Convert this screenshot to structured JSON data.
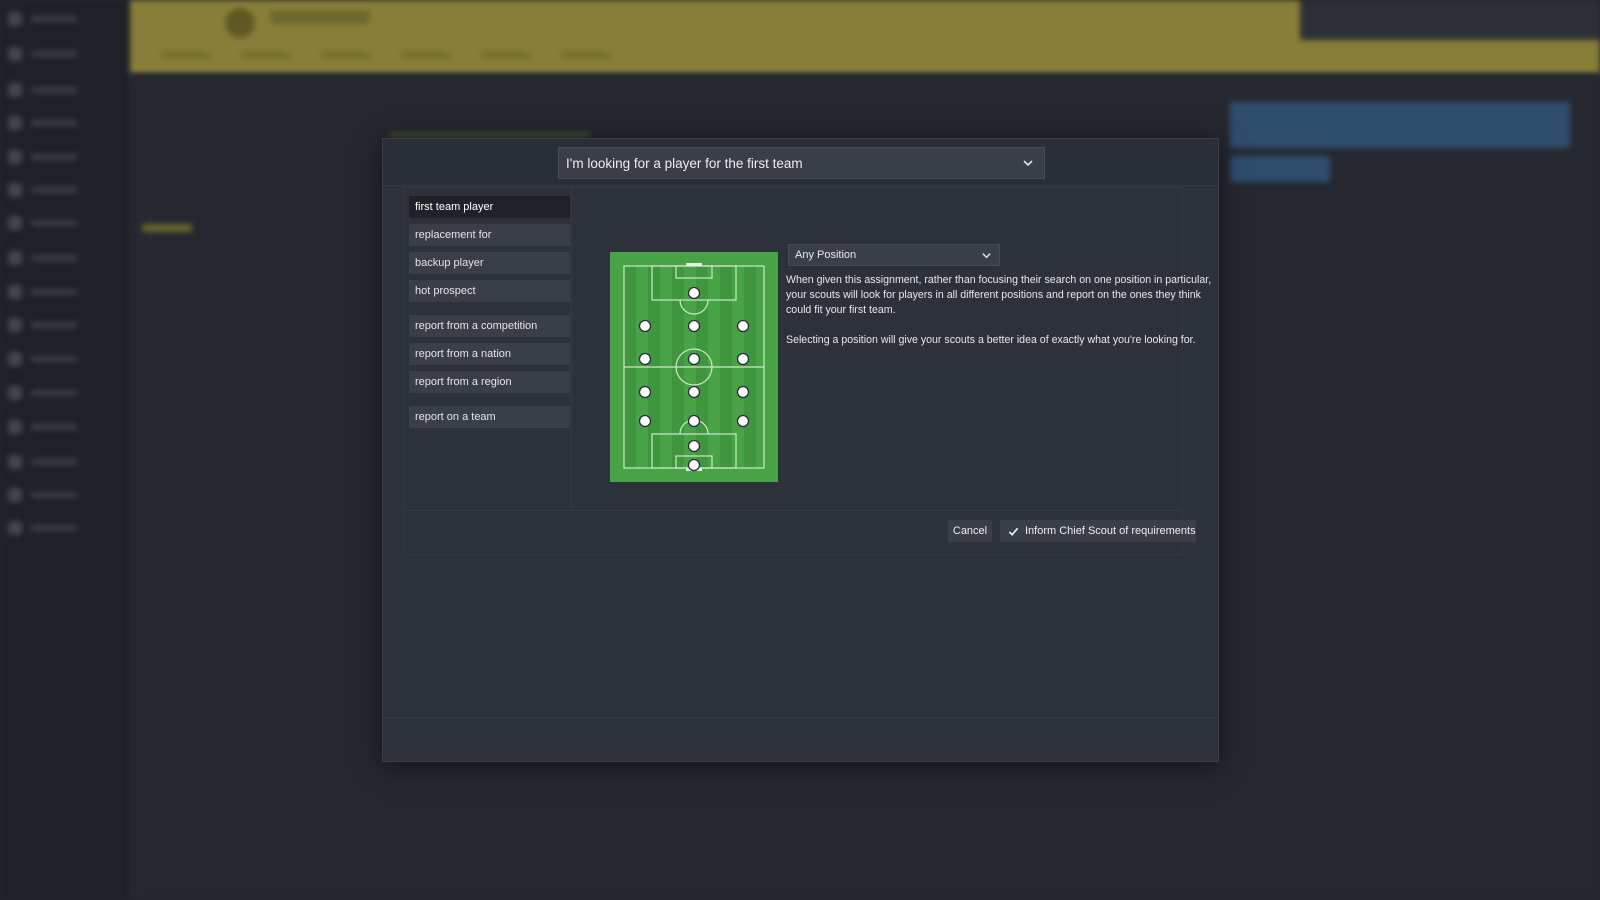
{
  "dialog": {
    "assignment_type": "I'm looking for a player for the first team",
    "options_group1": [
      "first team player",
      "replacement for",
      "backup player",
      "hot prospect"
    ],
    "options_group2": [
      "report from a competition",
      "report from a nation",
      "report from a region"
    ],
    "options_group3": [
      "report on a team"
    ],
    "selected_option": "first team player",
    "position_select": "Any Position",
    "description": [
      "When given this assignment, rather than focusing their search on one position in particular, your scouts will look for players in all different positions and report on the ones they think could fit your first team.",
      "Selecting a position will give your scouts a better idea of exactly what you're looking for."
    ],
    "cancel_label": "Cancel",
    "confirm_label": "Inform Chief Scout of requirements"
  },
  "icons": [
    "chevron-down-icon",
    "checkmark-icon"
  ],
  "colors": {
    "pitch_green": "#48a246",
    "pitch_stripe": "#3f963e",
    "header_yellow": "#c8b64a",
    "dialog_bg": "#2d3139",
    "option_bg": "#3a3e47",
    "option_active_bg": "#1f2228"
  }
}
